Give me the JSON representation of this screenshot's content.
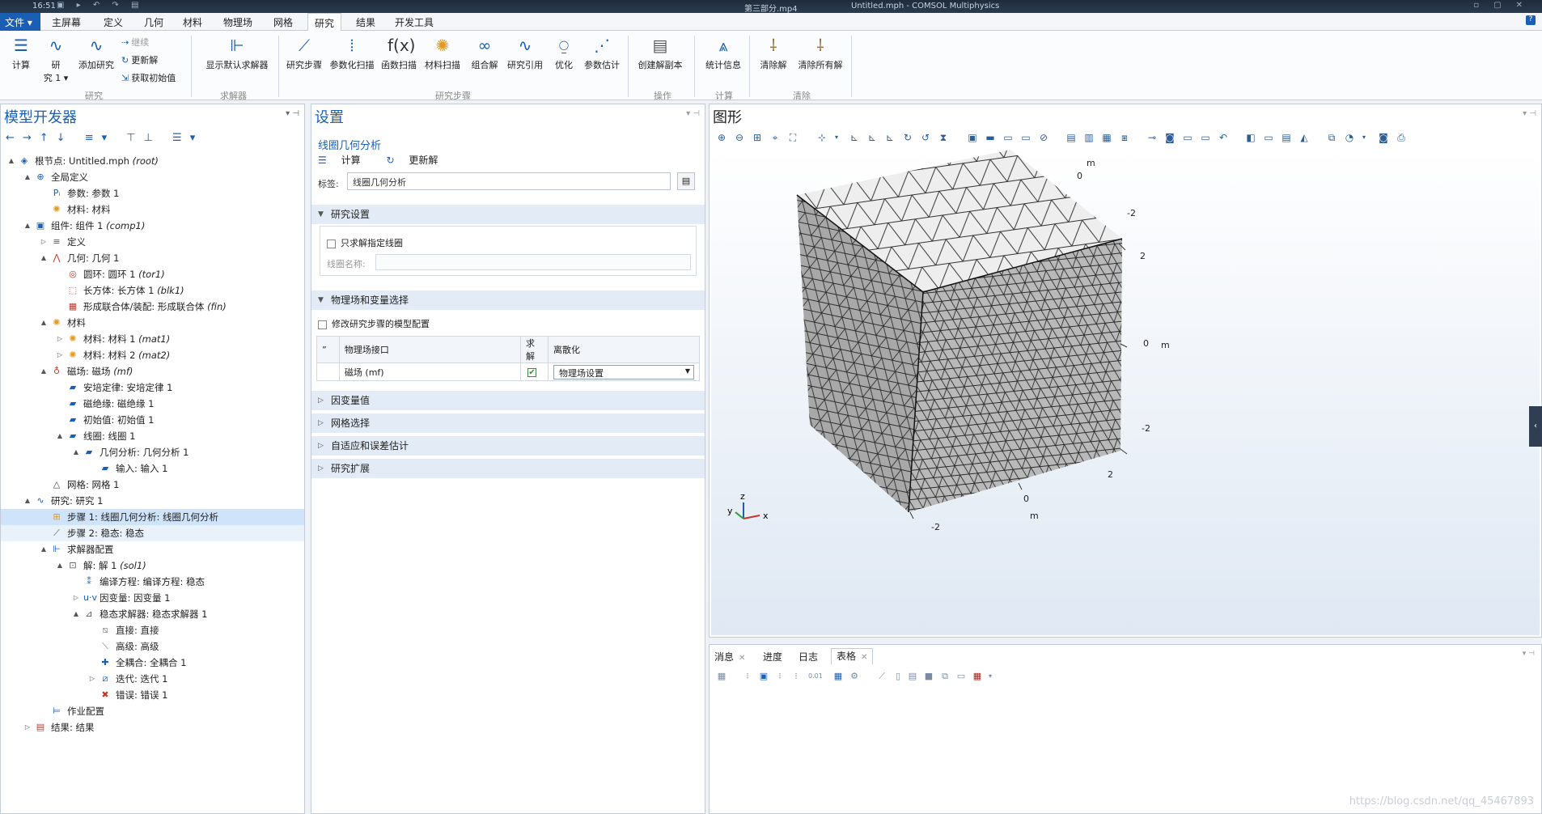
{
  "titlebar": {
    "clock": "16:51",
    "video_name": "第三部分.mp4",
    "window_title": "Untitled.mph - COMSOL Multiphysics"
  },
  "menubar": {
    "file": "文件 ▾",
    "tabs": [
      "主屏幕",
      "定义",
      "几何",
      "材料",
      "物理场",
      "网格",
      "研究",
      "结果",
      "开发工具"
    ],
    "active_tab": "研究"
  },
  "ribbon": {
    "compute": "计算",
    "study": "研\n究 1 ▾",
    "add_study": "添加研究",
    "continue": "继续",
    "update_solution": "更新解",
    "get_initial": "获取初始值",
    "group_study": "研究",
    "show_default_solver": "显示默认求解器",
    "group_solver": "求解器",
    "study_steps": "研究步骤",
    "param_sweep": "参数化扫描",
    "func_sweep": "函数扫描",
    "material_sweep": "材料扫描",
    "combine": "组合解",
    "study_ref": "研究引用",
    "optimize": "优化",
    "param_estimate": "参数估计",
    "group_study_steps": "研究步骤",
    "create_copy": "创建解副本",
    "group_ops": "操作",
    "stats": "统计信息",
    "group_calc": "计算",
    "clear_solution": "清除解",
    "clear_all": "清除所有解",
    "group_clear": "清除"
  },
  "builder": {
    "title": "模型开发器",
    "tree": [
      {
        "depth": 0,
        "arrow": "▲",
        "icon": "◈",
        "icolor": "#1a5fb4",
        "label": "根节点: Untitled.mph",
        "tag": "(root)"
      },
      {
        "depth": 1,
        "arrow": "▲",
        "icon": "⊕",
        "icolor": "#1a5fb4",
        "label": "全局定义",
        "tag": ""
      },
      {
        "depth": 2,
        "arrow": "",
        "icon": "Pᵢ",
        "icolor": "#1a5fb4",
        "label": "参数: 参数 1",
        "tag": ""
      },
      {
        "depth": 2,
        "arrow": "",
        "icon": "✺",
        "icolor": "#e39a1f",
        "label": "材料: 材料",
        "tag": ""
      },
      {
        "depth": 1,
        "arrow": "▲",
        "icon": "▣",
        "icolor": "#1a5fb4",
        "label": "组件: 组件 1",
        "tag": "(comp1)"
      },
      {
        "depth": 2,
        "arrow": "▷",
        "icon": "≡",
        "icolor": "#555",
        "label": "定义",
        "tag": ""
      },
      {
        "depth": 2,
        "arrow": "▲",
        "icon": "⋀",
        "icolor": "#c0392b",
        "label": "几何: 几何 1",
        "tag": ""
      },
      {
        "depth": 3,
        "arrow": "",
        "icon": "◎",
        "icolor": "#c0392b",
        "label": "圆环: 圆环 1",
        "tag": "(tor1)"
      },
      {
        "depth": 3,
        "arrow": "",
        "icon": "⬚",
        "icolor": "#c0392b",
        "label": "长方体: 长方体 1",
        "tag": "(blk1)"
      },
      {
        "depth": 3,
        "arrow": "",
        "icon": "▦",
        "icolor": "#c0392b",
        "label": "形成联合体/装配: 形成联合体",
        "tag": "(fin)"
      },
      {
        "depth": 2,
        "arrow": "▲",
        "icon": "✺",
        "icolor": "#e39a1f",
        "label": "材料",
        "tag": ""
      },
      {
        "depth": 3,
        "arrow": "▷",
        "icon": "✺",
        "icolor": "#e39a1f",
        "label": "材料: 材料 1",
        "tag": "(mat1)"
      },
      {
        "depth": 3,
        "arrow": "▷",
        "icon": "✺",
        "icolor": "#e39a1f",
        "label": "材料: 材料 2",
        "tag": "(mat2)"
      },
      {
        "depth": 2,
        "arrow": "▲",
        "icon": "♁",
        "icolor": "#c0392b",
        "label": "磁场: 磁场",
        "tag": "(mf)"
      },
      {
        "depth": 3,
        "arrow": "",
        "icon": "▰",
        "icolor": "#1a5fb4",
        "label": "安培定律: 安培定律 1",
        "tag": ""
      },
      {
        "depth": 3,
        "arrow": "",
        "icon": "▰",
        "icolor": "#1a5fb4",
        "label": "磁绝缘: 磁绝缘 1",
        "tag": ""
      },
      {
        "depth": 3,
        "arrow": "",
        "icon": "▰",
        "icolor": "#1a5fb4",
        "label": "初始值: 初始值 1",
        "tag": ""
      },
      {
        "depth": 3,
        "arrow": "▲",
        "icon": "▰",
        "icolor": "#1a5fb4",
        "label": "线圈: 线圈 1",
        "tag": ""
      },
      {
        "depth": 4,
        "arrow": "▲",
        "icon": "▰",
        "icolor": "#1a5fb4",
        "label": "几何分析: 几何分析 1",
        "tag": ""
      },
      {
        "depth": 5,
        "arrow": "",
        "icon": "▰",
        "icolor": "#1a5fb4",
        "label": "输入: 输入 1",
        "tag": ""
      },
      {
        "depth": 2,
        "arrow": "",
        "icon": "△",
        "icolor": "#444",
        "label": "网格: 网格 1",
        "tag": ""
      },
      {
        "depth": 1,
        "arrow": "▲",
        "icon": "∿",
        "icolor": "#1a5fb4",
        "label": "研究: 研究 1",
        "tag": ""
      },
      {
        "depth": 2,
        "arrow": "",
        "icon": "⊞",
        "icolor": "#e39a1f",
        "label": "步骤 1: 线圈几何分析: 线圈几何分析",
        "tag": ""
      },
      {
        "depth": 2,
        "arrow": "",
        "icon": "⟋",
        "icolor": "#555",
        "label": "步骤 2: 稳态: 稳态",
        "tag": ""
      },
      {
        "depth": 2,
        "arrow": "▲",
        "icon": "⊩",
        "icolor": "#1a5fb4",
        "label": "求解器配置",
        "tag": ""
      },
      {
        "depth": 3,
        "arrow": "▲",
        "icon": "⊡",
        "icolor": "#555",
        "label": "解: 解 1",
        "tag": "(sol1)"
      },
      {
        "depth": 4,
        "arrow": "",
        "icon": "⁑",
        "icolor": "#1a5fb4",
        "label": "编译方程: 编译方程: 稳态",
        "tag": ""
      },
      {
        "depth": 4,
        "arrow": "▷",
        "icon": "u·v",
        "icolor": "#1a5fb4",
        "label": "因变量: 因变量 1",
        "tag": ""
      },
      {
        "depth": 4,
        "arrow": "▲",
        "icon": "⊿",
        "icolor": "#555",
        "label": "稳态求解器: 稳态求解器 1",
        "tag": ""
      },
      {
        "depth": 5,
        "arrow": "",
        "icon": "⧅",
        "icolor": "#777",
        "label": "直接: 直接",
        "tag": ""
      },
      {
        "depth": 5,
        "arrow": "",
        "icon": "⟍",
        "icolor": "#777",
        "label": "高级: 高级",
        "tag": ""
      },
      {
        "depth": 5,
        "arrow": "",
        "icon": "✚",
        "icolor": "#1a5fb4",
        "label": "全耦合: 全耦合 1",
        "tag": ""
      },
      {
        "depth": 5,
        "arrow": "▷",
        "icon": "⧄",
        "icolor": "#1a5fb4",
        "label": "迭代: 迭代 1",
        "tag": ""
      },
      {
        "depth": 5,
        "arrow": "",
        "icon": "✖",
        "icolor": "#c0392b",
        "label": "错误: 错误 1",
        "tag": ""
      },
      {
        "depth": 2,
        "arrow": "",
        "icon": "⊨",
        "icolor": "#1a5fb4",
        "label": "作业配置",
        "tag": ""
      },
      {
        "depth": 1,
        "arrow": "▷",
        "icon": "▤",
        "icolor": "#c0392b",
        "label": "结果: 结果",
        "tag": ""
      }
    ]
  },
  "settings": {
    "title": "设置",
    "subtitle": "线圈几何分析",
    "compute": "计算",
    "update": "更新解",
    "label_caption": "标签:",
    "label_value": "线圈几何分析",
    "study_settings": "研究设置",
    "only_specified_coil": "只求解指定线圈",
    "coil_name_caption": "线圈名称:",
    "physics_selection": "物理场和变量选择",
    "modify_config": "修改研究步骤的模型配置",
    "col_interface": "物理场接口",
    "col_solve": "求解",
    "col_discret": "离散化",
    "row_interface": "磁场 (mf)",
    "row_discret": "物理场设置",
    "dep_vars": "因变量值",
    "mesh_select": "网格选择",
    "adaptive": "自适应和误差估计",
    "extensions": "研究扩展"
  },
  "graphics": {
    "title": "图形",
    "axis_unit": "m",
    "ticks_top": [
      "0",
      "-2",
      "2"
    ],
    "tick_mid": "0",
    "ticks_right": [
      "-2",
      "2"
    ],
    "ticks_bottom": [
      "0",
      "-2"
    ],
    "triad": {
      "x": "x",
      "y": "y",
      "z": "z"
    }
  },
  "messages": {
    "tabs": [
      "消息",
      "进度",
      "日志",
      "表格"
    ],
    "active_tab": "表格"
  },
  "watermark": "https://blog.csdn.net/qq_45467893"
}
